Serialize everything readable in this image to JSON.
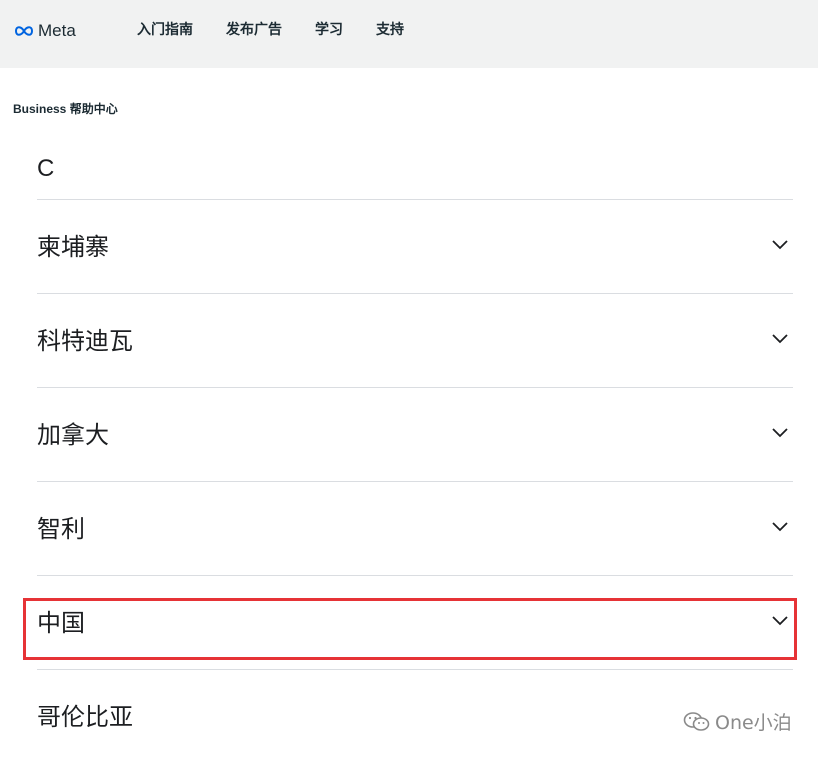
{
  "header": {
    "logo_text": "Meta",
    "nav": [
      "入门指南",
      "发布广告",
      "学习",
      "支持"
    ]
  },
  "breadcrumb": "Business 帮助中心",
  "section_letter": "C",
  "countries": [
    {
      "label": "柬埔寨",
      "highlighted": false
    },
    {
      "label": "科特迪瓦",
      "highlighted": false
    },
    {
      "label": "加拿大",
      "highlighted": false
    },
    {
      "label": "智利",
      "highlighted": false
    },
    {
      "label": "中国",
      "highlighted": true
    },
    {
      "label": "哥伦比亚",
      "highlighted": false
    }
  ],
  "watermark_text": "One小泊",
  "colors": {
    "header_bg": "#f1f2f2",
    "highlight_border": "#e63336",
    "meta_blue": "#0064e0"
  },
  "icons": {
    "logo": "meta-infinity-icon",
    "row_expand": "chevron-down-icon",
    "watermark": "wechat-icon"
  }
}
